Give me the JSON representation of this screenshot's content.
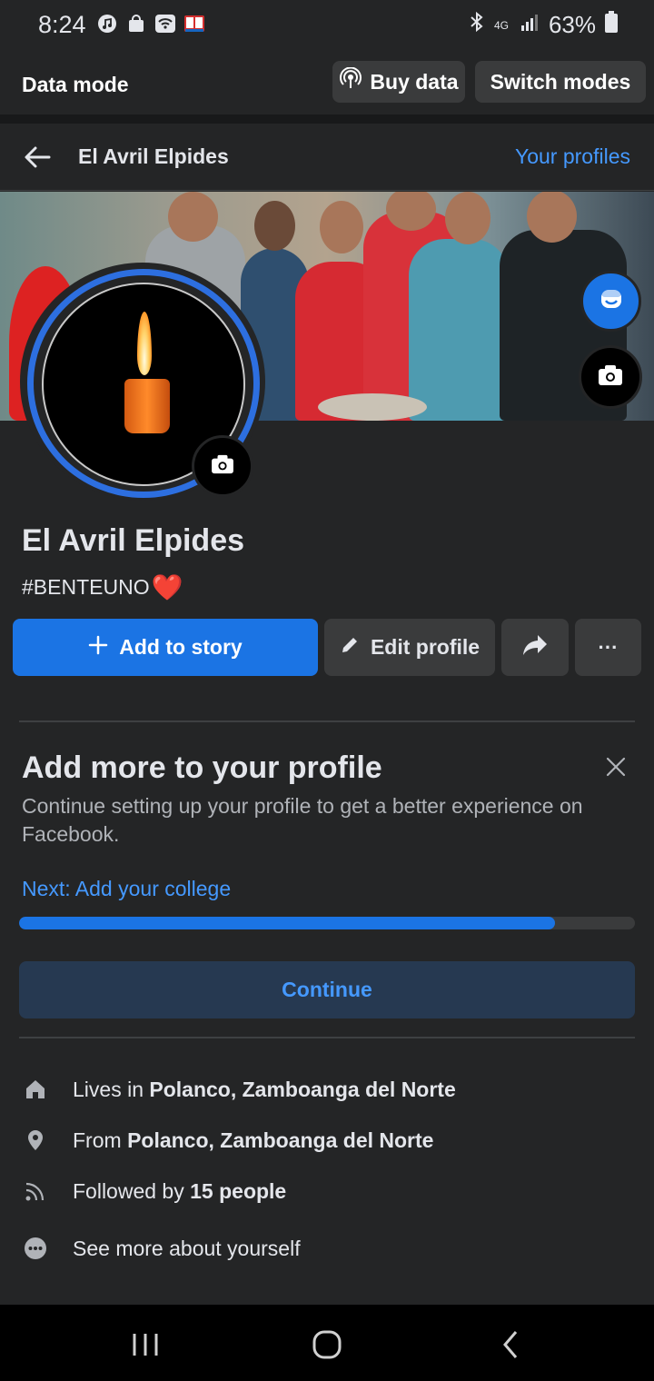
{
  "status_bar": {
    "time": "8:24",
    "network": "4G",
    "battery": "63%"
  },
  "data_bar": {
    "title": "Data mode",
    "buy_label": "Buy data",
    "switch_label": "Switch modes"
  },
  "header": {
    "name": "El Avril Elpides",
    "profiles_link": "Your profiles"
  },
  "profile": {
    "name": "El Avril Elpides",
    "bio": "#BENTEUNO",
    "bio_emoji": "❤️"
  },
  "actions": {
    "add_story": "Add to story",
    "edit_profile": "Edit profile",
    "more": "···"
  },
  "completion_card": {
    "title": "Add more to your profile",
    "description": "Continue setting up your profile to get a better experience on Facebook.",
    "next_link": "Next: Add your college",
    "progress_percent": 87,
    "continue_label": "Continue"
  },
  "details": [
    {
      "icon": "home-icon",
      "prefix": "Lives in ",
      "value": "Polanco, Zamboanga del Norte"
    },
    {
      "icon": "location-pin-icon",
      "prefix": "From ",
      "value": "Polanco, Zamboanga del Norte"
    },
    {
      "icon": "rss-followers-icon",
      "prefix": "Followed by ",
      "value": "15 people"
    },
    {
      "icon": "more-dots-icon",
      "prefix": "See more about yourself",
      "value": ""
    }
  ],
  "colors": {
    "accent": "#1b74e4",
    "link": "#4599ff",
    "background": "#242526"
  }
}
